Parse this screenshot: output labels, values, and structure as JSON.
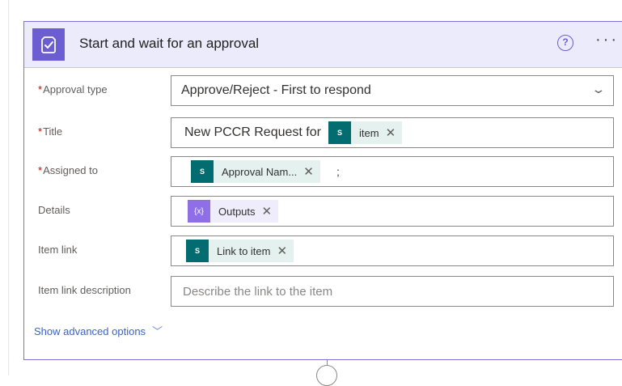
{
  "header": {
    "title": "Start and wait for an approval",
    "icon": "approval-icon",
    "help_icon": "question-icon",
    "more_label": "···"
  },
  "fields": {
    "approval_type": {
      "label": "Approval type",
      "required": "*",
      "value": "Approve/Reject - First to respond"
    },
    "title": {
      "label": "Title",
      "required": "*",
      "text": "New PCCR Request for",
      "token_label": "item",
      "token_x": "✕"
    },
    "assigned_to": {
      "label": "Assigned to",
      "required": "*",
      "token_label": "Approval Nam...",
      "token_x": "✕",
      "suffix": ";"
    },
    "details": {
      "label": "Details",
      "token_label": "Outputs",
      "token_x": "✕",
      "token_icon_text": "{x}"
    },
    "item_link": {
      "label": "Item link",
      "token_label": "Link to item",
      "token_x": "✕"
    },
    "item_link_description": {
      "label": "Item link description",
      "placeholder": "Describe the link to the item"
    }
  },
  "advanced": {
    "label": "Show advanced options",
    "chevron": "﹀"
  },
  "token_icon_text": "S",
  "colors": {
    "accent": "#6c5dd3",
    "sharepoint": "#036c70",
    "expression": "#8e6fe8",
    "link": "#3b63c4"
  }
}
